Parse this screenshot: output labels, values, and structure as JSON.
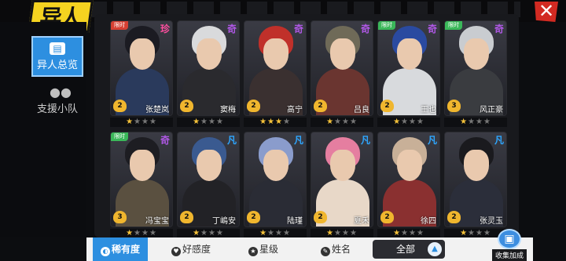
{
  "header": {
    "logo_text": "异人",
    "close_label": "✕"
  },
  "nav": {
    "items": [
      {
        "label": "异人总览",
        "icon": "clipboard-icon",
        "active": true
      },
      {
        "label": "支援小队",
        "icon": "people-icon",
        "active": false
      }
    ]
  },
  "cards": [
    {
      "tag": "限时",
      "tag_color": "red",
      "rank": "珍",
      "rank_color": "pink",
      "level": "2",
      "name": "张楚岚",
      "stars": 1,
      "hair": "#1b1b22",
      "body": "#2a3a5c"
    },
    {
      "tag": "",
      "rank": "奇",
      "rank_color": "purple",
      "level": "2",
      "name": "窦梅",
      "stars": 1,
      "hair": "#d9dadc",
      "body": "#2a2a2e"
    },
    {
      "tag": "",
      "rank": "奇",
      "rank_color": "purple",
      "level": "2",
      "name": "高宁",
      "stars": 3,
      "hair": "#c0302a",
      "body": "#3a3030"
    },
    {
      "tag": "",
      "rank": "奇",
      "rank_color": "purple",
      "level": "2",
      "name": "吕良",
      "stars": 1,
      "hair": "#6f6a58",
      "body": "#6a3530"
    },
    {
      "tag": "限时",
      "tag_color": "green",
      "rank": "奇",
      "rank_color": "purple",
      "level": "2",
      "name": "王也",
      "stars": 1,
      "hair": "#2a4aa0",
      "body": "#d8dadd"
    },
    {
      "tag": "限时",
      "tag_color": "green",
      "rank": "奇",
      "rank_color": "purple",
      "level": "3",
      "name": "风正豪",
      "stars": 1,
      "hair": "#c9ccd0",
      "body": "#3a3c40"
    },
    {
      "tag": "限时",
      "tag_color": "green",
      "rank": "奇",
      "rank_color": "purple",
      "level": "3",
      "name": "冯宝宝",
      "stars": 1,
      "hair": "#1d1d22",
      "body": "#5a5040"
    },
    {
      "tag": "",
      "rank": "凡",
      "rank_color": "blue",
      "level": "2",
      "name": "丁嶋安",
      "stars": 1,
      "hair": "#3a5a90",
      "body": "#222226"
    },
    {
      "tag": "",
      "rank": "凡",
      "rank_color": "blue",
      "level": "2",
      "name": "陆瑾",
      "stars": 1,
      "hair": "#8a9ccc",
      "body": "#2a2c35"
    },
    {
      "tag": "",
      "rank": "凡",
      "rank_color": "blue",
      "level": "2",
      "name": "夏禾",
      "stars": 1,
      "hair": "#e57ea0",
      "body": "#e8d8c8"
    },
    {
      "tag": "",
      "rank": "凡",
      "rank_color": "blue",
      "level": "2",
      "name": "徐四",
      "stars": 1,
      "hair": "#c8b098",
      "body": "#8a3030"
    },
    {
      "tag": "",
      "rank": "凡",
      "rank_color": "blue",
      "level": "2",
      "name": "张灵玉",
      "stars": 1,
      "hair": "#1a1a1e",
      "body": "#2b2e3a"
    }
  ],
  "bottom": {
    "tabs": [
      {
        "label": "稀有度",
        "icon": "rarity-icon",
        "active": true
      },
      {
        "label": "好感度",
        "icon": "heart-icon",
        "active": false
      },
      {
        "label": "星级",
        "icon": "star-icon",
        "active": false
      },
      {
        "label": "姓名",
        "icon": "name-icon",
        "active": false
      }
    ],
    "filter_label": "全部",
    "collect_label": "收集加成"
  },
  "colors": {
    "accent": "#2d8fe0",
    "logo": "#f5d320",
    "close": "#d22a22"
  }
}
